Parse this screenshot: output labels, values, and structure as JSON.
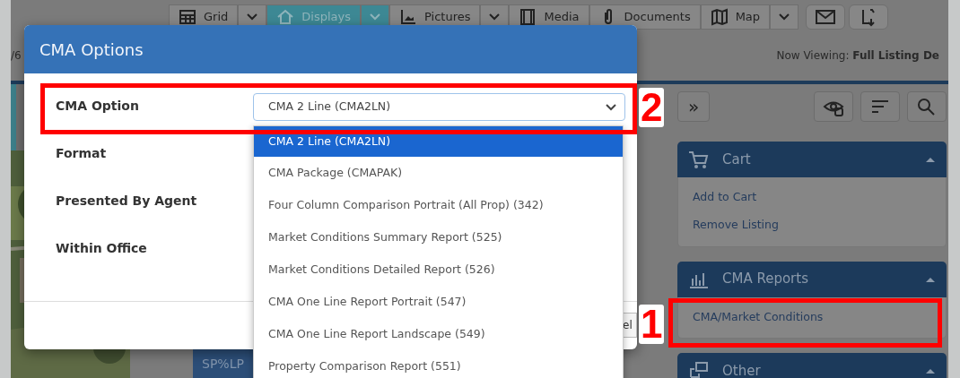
{
  "toolbar": {
    "buttons": [
      {
        "label": "Grid",
        "selected": false,
        "menu": true
      },
      {
        "label": "Displays",
        "selected": true,
        "menu": true
      },
      {
        "label": "Pictures",
        "selected": false,
        "menu": true
      },
      {
        "label": "Media",
        "selected": false,
        "menu": false
      },
      {
        "label": "Documents",
        "selected": false,
        "menu": false
      },
      {
        "label": "Map",
        "selected": false,
        "menu": true
      }
    ]
  },
  "pager": "/6",
  "now_viewing": "Now Viewing: **Full Listing De**",
  "sidebar": {
    "expand_button": "»",
    "panels": [
      {
        "title": "Cart",
        "expanded": true,
        "items": [
          {
            "label": "Add to Cart"
          },
          {
            "label": "Remove Listing"
          }
        ]
      },
      {
        "title": "CMA Reports",
        "expanded": true,
        "items": [
          {
            "label": "CMA/Market Conditions"
          }
        ]
      },
      {
        "title": "Other",
        "expanded": true
      }
    ]
  },
  "stat_button": "SP%LP",
  "modal": {
    "title": "CMA Options",
    "fields": [
      {
        "label": "Format"
      },
      {
        "label": "Presented By Agent"
      },
      {
        "label": "Within Office"
      }
    ],
    "cma_option": {
      "label": "CMA Option",
      "value": "CMA 2 Line (CMA2LN)",
      "options": [
        {
          "label": "CMA 2 Line (CMA2LN)",
          "selected": true
        },
        {
          "label": "CMA Package (CMAPAK)",
          "selected": false
        },
        {
          "label": "Four Column Comparison Portrait (All Prop) (342)",
          "selected": false
        },
        {
          "label": "Market Conditions Summary Report (525)",
          "selected": false
        },
        {
          "label": "Market Conditions Detailed Report (526)",
          "selected": false
        },
        {
          "label": "CMA One Line Report Portrait (547)",
          "selected": false
        },
        {
          "label": "CMA One Line Report Landscape (549)",
          "selected": false
        },
        {
          "label": "Property Comparison Report (551)",
          "selected": false
        }
      ]
    },
    "footer_button": "el"
  },
  "annotations": [
    {
      "number": "2"
    },
    {
      "number": "1"
    }
  ]
}
